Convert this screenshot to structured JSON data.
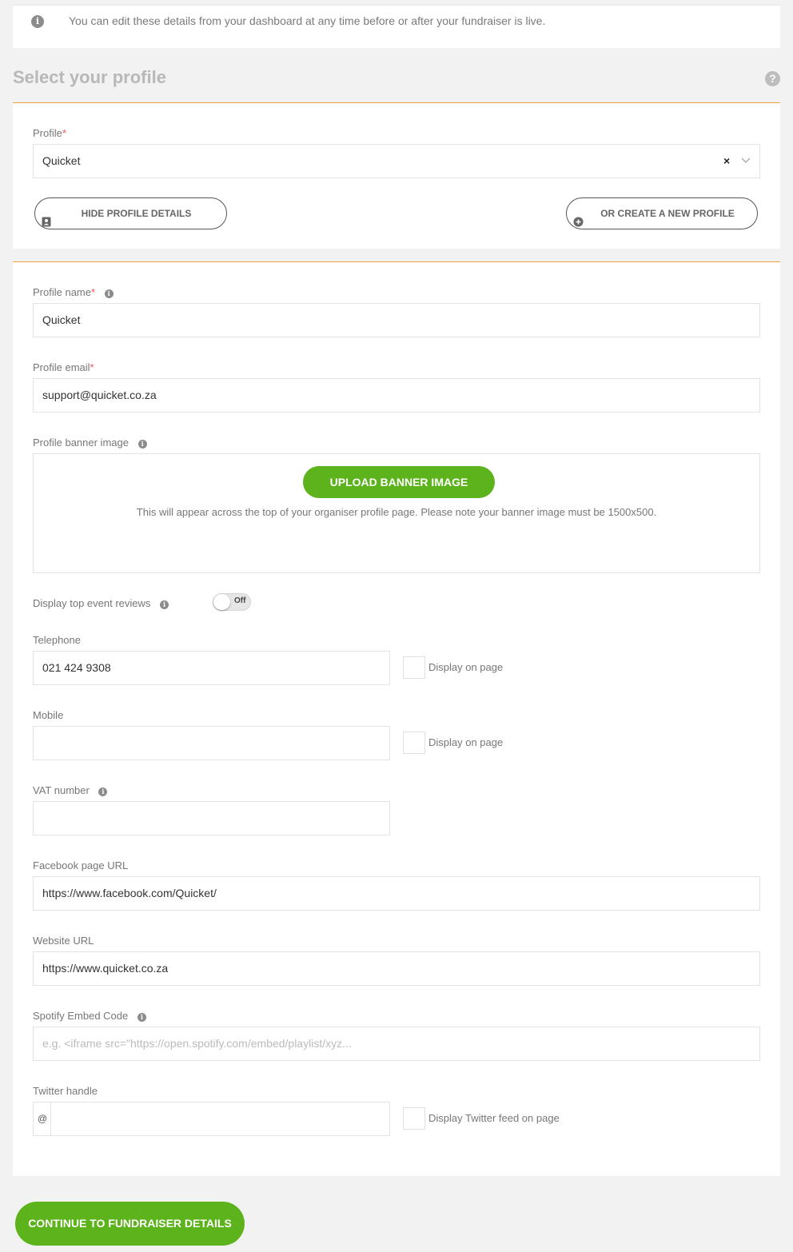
{
  "banner": {
    "info_icon": "info-icon",
    "text": "You can edit these details from your dashboard at any time before or after your fundraiser is live."
  },
  "section": {
    "title": "Select your profile",
    "help_icon": "question-icon"
  },
  "profile_select": {
    "label": "Profile",
    "required_mark": "*",
    "value": "Quicket",
    "clear_symbol": "×",
    "chevron_icon": "chevron-down-icon"
  },
  "buttons": {
    "hide_profile_details": "HIDE PROFILE DETAILS",
    "create_new_profile": "OR CREATE A NEW PROFILE",
    "upload_banner": "UPLOAD BANNER IMAGE",
    "continue": "CONTINUE TO FUNDRAISER DETAILS"
  },
  "form": {
    "profile_name": {
      "label": "Profile name",
      "required_mark": "*",
      "value": "Quicket"
    },
    "profile_email": {
      "label": "Profile email",
      "required_mark": "*",
      "value": "support@quicket.co.za"
    },
    "banner_image": {
      "label": "Profile banner image",
      "note": "This will appear across the top of your organiser profile page. Please note your banner image must be 1500x500."
    },
    "top_reviews": {
      "label": "Display top event reviews",
      "toggle_text": "Off"
    },
    "telephone": {
      "label": "Telephone",
      "value": "021 424 9308",
      "display_label": "Display on page"
    },
    "mobile": {
      "label": "Mobile",
      "value": "",
      "display_label": "Display on page"
    },
    "vat": {
      "label": "VAT number",
      "value": ""
    },
    "facebook": {
      "label": "Facebook page URL",
      "value": "https://www.facebook.com/Quicket/"
    },
    "website": {
      "label": "Website URL",
      "value": "https://www.quicket.co.za"
    },
    "spotify": {
      "label": "Spotify Embed Code",
      "placeholder": "e.g. <iframe src=\"https://open.spotify.com/embed/playlist/xyz..."
    },
    "twitter": {
      "label": "Twitter handle",
      "prefix": "@",
      "value": "",
      "display_label": "Display Twitter feed on page"
    }
  },
  "colors": {
    "accent_orange": "#e8a33d",
    "primary_green": "#5cb31c",
    "required_red": "#e55555"
  }
}
